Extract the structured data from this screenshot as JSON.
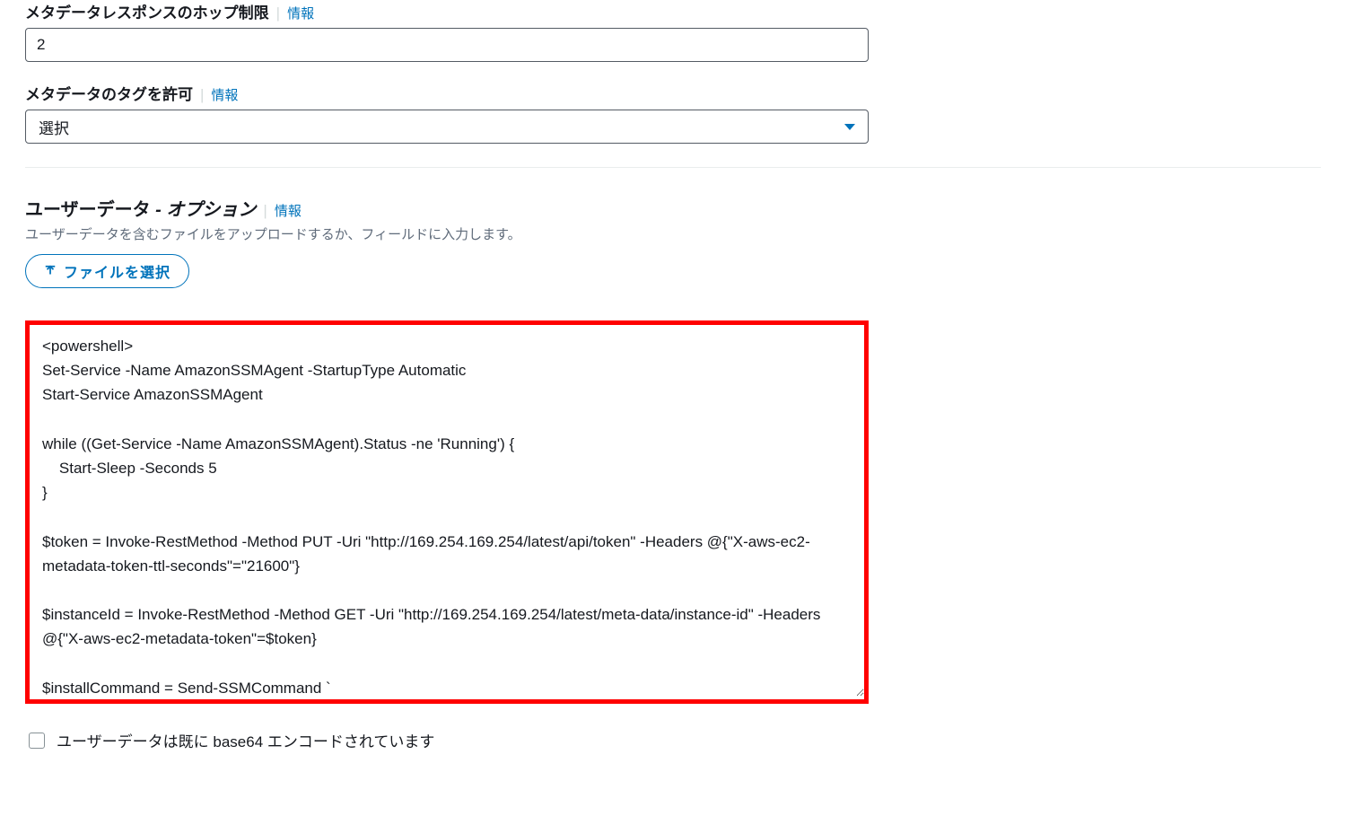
{
  "hop_limit": {
    "label": "メタデータレスポンスのホップ制限",
    "info": "情報",
    "value": "2"
  },
  "allow_tags": {
    "label": "メタデータのタグを許可",
    "info": "情報",
    "selected": "選択"
  },
  "user_data": {
    "title": "ユーザーデータ",
    "optional": " - オプション",
    "info": "情報",
    "help": "ユーザーデータを含むファイルをアップロードするか、フィールドに入力します。",
    "upload_button": "ファイルを選択",
    "textarea_value": "<powershell>\nSet-Service -Name AmazonSSMAgent -StartupType Automatic\nStart-Service AmazonSSMAgent\n\nwhile ((Get-Service -Name AmazonSSMAgent).Status -ne 'Running') {\n    Start-Sleep -Seconds 5\n}\n\n$token = Invoke-RestMethod -Method PUT -Uri \"http://169.254.169.254/latest/api/token\" -Headers @{\"X-aws-ec2-metadata-token-ttl-seconds\"=\"21600\"}\n\n$instanceId = Invoke-RestMethod -Method GET -Uri \"http://169.254.169.254/latest/meta-data/instance-id\" -Headers @{\"X-aws-ec2-metadata-token\"=$token}\n\n$installCommand = Send-SSMCommand `",
    "base64_checkbox_label": "ユーザーデータは既に base64 エンコードされています"
  }
}
